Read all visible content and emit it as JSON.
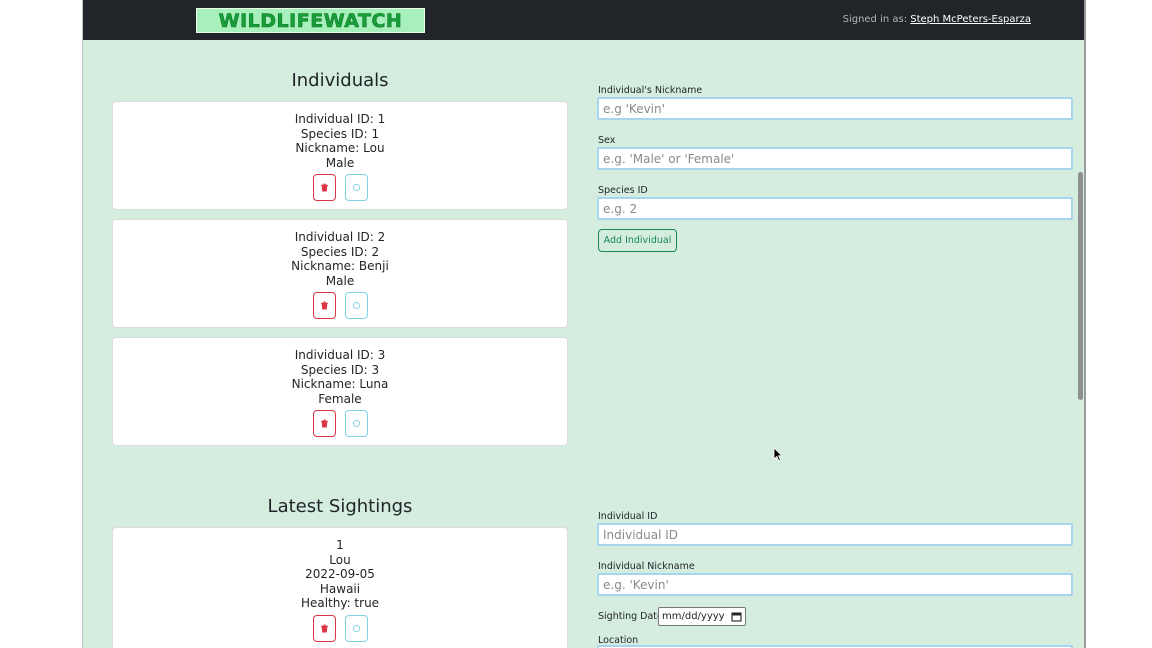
{
  "navbar": {
    "brand": "WILDLIFEWATCH",
    "signed_in_prefix": "Signed in as: ",
    "user_name": "Steph McPeters-Esparza"
  },
  "individuals": {
    "title": "Individuals",
    "cards": [
      {
        "line1": "Individual ID: 1",
        "line2": "Species ID: 1",
        "line3": "Nickname: Lou",
        "line4": "Male"
      },
      {
        "line1": "Individual ID: 2",
        "line2": "Species ID: 2",
        "line3": "Nickname: Benji",
        "line4": "Male"
      },
      {
        "line1": "Individual ID: 3",
        "line2": "Species ID: 3",
        "line3": "Nickname: Luna",
        "line4": "Female"
      }
    ]
  },
  "individual_form": {
    "nickname_label": "Individual's Nickname",
    "nickname_placeholder": "e.g 'Kevin'",
    "sex_label": "Sex",
    "sex_placeholder": "e.g. 'Male' or 'Female'",
    "species_label": "Species ID",
    "species_placeholder": "e.g. 2",
    "add_button": "Add Individual"
  },
  "sightings": {
    "title": "Latest Sightings",
    "cards": [
      {
        "line1": "1",
        "line2": "Lou",
        "line3": "2022-09-05",
        "line4": "Hawaii",
        "line5": "Healthy: true"
      }
    ]
  },
  "sighting_form": {
    "individual_id_label": "Individual ID",
    "individual_id_placeholder": "Individual ID",
    "nickname_label": "Individual Nickname",
    "nickname_placeholder": "e.g. 'Kevin'",
    "date_label": "Sighting Date",
    "date_value": "mm/dd/yyyy",
    "location_label": "Location"
  },
  "colors": {
    "page_bg": "#d4eddf",
    "navbar_bg": "#212529",
    "brand_green": "#1a9e3a",
    "delete_red": "#dc3545",
    "edit_cyan": "#7fd3e6",
    "add_green": "#198754"
  },
  "icons": {
    "delete": "trash-icon",
    "edit": "refresh-icon",
    "calendar": "calendar-icon"
  }
}
